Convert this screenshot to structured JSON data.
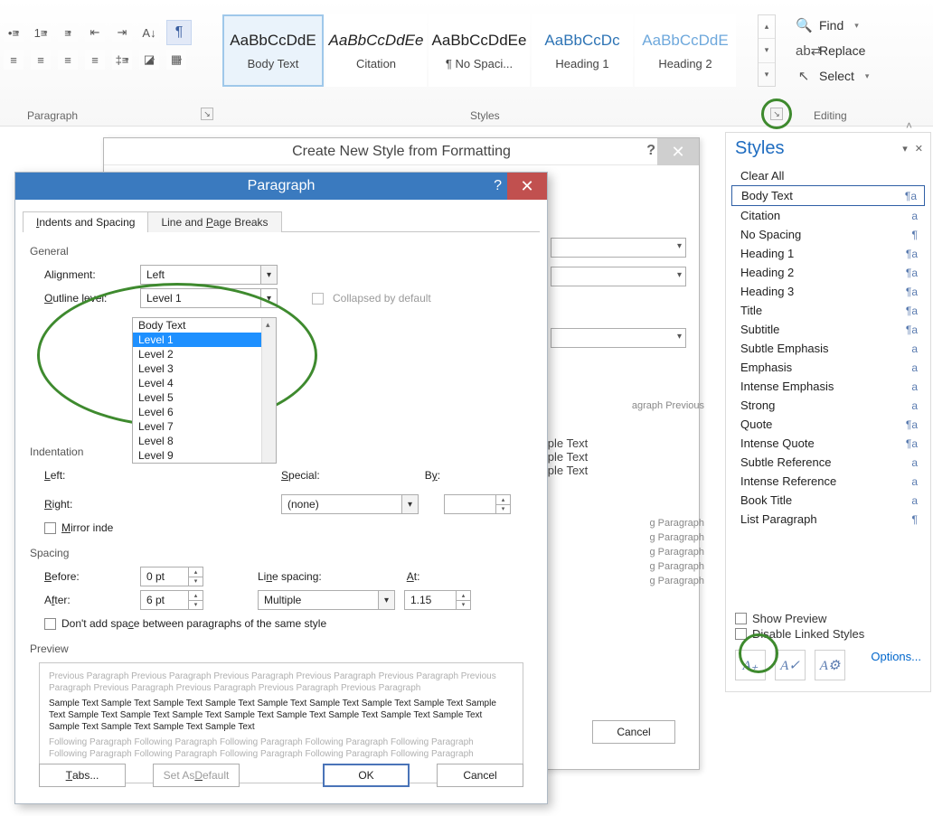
{
  "ribbon": {
    "groups": {
      "paragraph": "Paragraph",
      "styles": "Styles",
      "editing": "Editing"
    },
    "pilcrow": "¶",
    "stylesGallery": [
      {
        "sample": "AaBbCcDdE",
        "label": "Body Text",
        "cls": "sample",
        "sel": true
      },
      {
        "sample": "AaBbCcDdEe",
        "label": "Citation",
        "cls": "sample samp-citation"
      },
      {
        "sample": "AaBbCcDdEe",
        "label": "¶ No Spaci...",
        "cls": "sample"
      },
      {
        "sample": "AaBbCcDc",
        "label": "Heading 1",
        "cls": "samp-heading"
      },
      {
        "sample": "AaBbCcDdE",
        "label": "Heading 2",
        "cls": "samp-h2"
      }
    ],
    "editing": {
      "find": "Find",
      "replace": "Replace",
      "select": "Select"
    }
  },
  "createStyle": {
    "title": "Create New Style from Formatting",
    "previewHeader": "agraph Previous",
    "sample": "Sample Text",
    "followRows": "g Paragraph",
    "cancel": "Cancel"
  },
  "paragraphDialog": {
    "title": "Paragraph",
    "tabs": {
      "indents": "Indents and Spacing",
      "breaks": "Line and Page Breaks"
    },
    "sections": {
      "general": "General",
      "indentation": "Indentation",
      "spacing": "Spacing",
      "preview": "Preview"
    },
    "labels": {
      "alignment": "Alignment:",
      "outline": "Outline level:",
      "collapsed": "Collapsed by default",
      "left": "Left:",
      "right": "Right:",
      "mirror": "Mirror inde",
      "special": "Special:",
      "by": "By:",
      "before": "Before:",
      "after": "After:",
      "linespacing": "Line spacing:",
      "at": "At:",
      "dontadd": "Don't add space between paragraphs of the same style"
    },
    "values": {
      "alignment": "Left",
      "outline": "Level 1",
      "specialValue": "(none)",
      "byValue": "",
      "before": "0 pt",
      "after": "6 pt",
      "linespacingValue": "Multiple",
      "atValue": "1.15"
    },
    "outlineOptions": [
      "Body Text",
      "Level 1",
      "Level 2",
      "Level 3",
      "Level 4",
      "Level 5",
      "Level 6",
      "Level 7",
      "Level 8",
      "Level 9"
    ],
    "outlineSelectedIndex": 1,
    "preview": {
      "ghostPrev": "Previous Paragraph Previous Paragraph Previous Paragraph Previous Paragraph Previous Paragraph Previous Paragraph Previous Paragraph Previous Paragraph Previous Paragraph Previous Paragraph",
      "body": "Sample Text Sample Text Sample Text Sample Text Sample Text Sample Text Sample Text Sample Text Sample Text Sample Text Sample Text Sample Text Sample Text Sample Text Sample Text Sample Text Sample Text Sample Text Sample Text Sample Text Sample Text",
      "ghostNext": "Following Paragraph Following Paragraph Following Paragraph Following Paragraph Following Paragraph Following Paragraph Following Paragraph Following Paragraph Following Paragraph Following Paragraph"
    },
    "buttons": {
      "tabs": "Tabs...",
      "setDefault": "Set As Default",
      "ok": "OK",
      "cancel": "Cancel"
    }
  },
  "stylesPane": {
    "title": "Styles",
    "items": [
      {
        "name": "Clear All",
        "glyph": "",
        "sel": false
      },
      {
        "name": "Body Text",
        "glyph": "¶a",
        "sel": true
      },
      {
        "name": "Citation",
        "glyph": "a",
        "sel": false
      },
      {
        "name": "No Spacing",
        "glyph": "¶",
        "sel": false
      },
      {
        "name": "Heading 1",
        "glyph": "¶a",
        "sel": false
      },
      {
        "name": "Heading 2",
        "glyph": "¶a",
        "sel": false
      },
      {
        "name": "Heading 3",
        "glyph": "¶a",
        "sel": false
      },
      {
        "name": "Title",
        "glyph": "¶a",
        "sel": false
      },
      {
        "name": "Subtitle",
        "glyph": "¶a",
        "sel": false
      },
      {
        "name": "Subtle Emphasis",
        "glyph": "a",
        "sel": false
      },
      {
        "name": "Emphasis",
        "glyph": "a",
        "sel": false
      },
      {
        "name": "Intense Emphasis",
        "glyph": "a",
        "sel": false
      },
      {
        "name": "Strong",
        "glyph": "a",
        "sel": false
      },
      {
        "name": "Quote",
        "glyph": "¶a",
        "sel": false
      },
      {
        "name": "Intense Quote",
        "glyph": "¶a",
        "sel": false
      },
      {
        "name": "Subtle Reference",
        "glyph": "a",
        "sel": false
      },
      {
        "name": "Intense Reference",
        "glyph": "a",
        "sel": false
      },
      {
        "name": "Book Title",
        "glyph": "a",
        "sel": false
      },
      {
        "name": "List Paragraph",
        "glyph": "¶",
        "sel": false
      }
    ],
    "showPreview": "Show Preview",
    "disableLinked": "Disable Linked Styles",
    "options": "Options..."
  }
}
